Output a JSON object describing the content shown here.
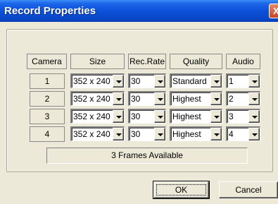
{
  "window": {
    "title": "Record Properties",
    "close_glyph": "X"
  },
  "table": {
    "headers": {
      "camera": "Camera",
      "size": "Size",
      "rec_rate": "Rec.Rate",
      "quality": "Quality",
      "audio": "Audio"
    },
    "rows": [
      {
        "camera": "1",
        "size": "352 x 240",
        "rec_rate": "30",
        "quality": "Standard",
        "audio": "1"
      },
      {
        "camera": "2",
        "size": "352 x 240",
        "rec_rate": "30",
        "quality": "Highest",
        "audio": "2"
      },
      {
        "camera": "3",
        "size": "352 x 240",
        "rec_rate": "30",
        "quality": "Highest",
        "audio": "3"
      },
      {
        "camera": "4",
        "size": "352 x 240",
        "rec_rate": "30",
        "quality": "Highest",
        "audio": "4"
      }
    ]
  },
  "status": {
    "frames_available": "3 Frames Available"
  },
  "buttons": {
    "ok": "OK",
    "cancel": "Cancel"
  },
  "colors": {
    "titlebar": "#0a4fd6",
    "dialog_bg": "#ece9d8",
    "close_button": "#c9431f"
  }
}
